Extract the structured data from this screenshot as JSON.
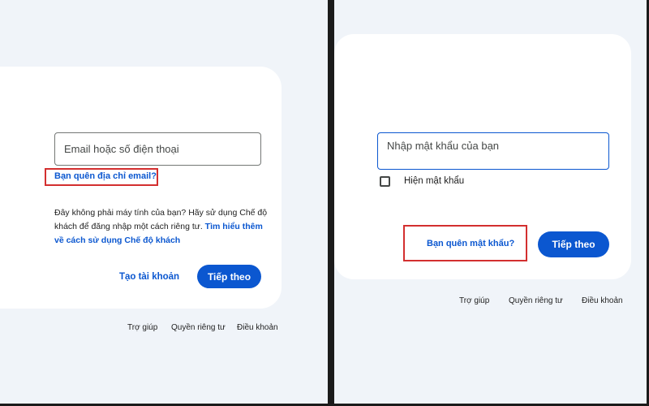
{
  "left_panel": {
    "email_placeholder": "Email hoặc số điện thoại",
    "forgot_email_link": "Bạn quên địa chỉ email?",
    "guest_info_text": "Đây không phải máy tính của bạn? Hãy sử dụng Chế độ khách để đăng nhập một cách riêng tư. ",
    "guest_info_link": "Tìm hiểu thêm về cách sử dụng Chế độ khách",
    "create_account_button": "Tạo tài khoản",
    "next_button": "Tiếp theo",
    "footer": {
      "help": "Trợ giúp",
      "privacy": "Quyền riêng tư",
      "terms": "Điều khoản"
    }
  },
  "right_panel": {
    "password_placeholder": "Nhập mật khẩu của bạn",
    "show_password_label": "Hiện mật khẩu",
    "forgot_password_link": "Bạn quên mật khẩu?",
    "next_button": "Tiếp theo",
    "footer": {
      "help": "Trợ giúp",
      "privacy": "Quyền riêng tư",
      "terms": "Điều khoản"
    }
  },
  "colors": {
    "background": "#f0f4f9",
    "card": "#ffffff",
    "accent": "#0b57d0",
    "highlight_border": "#d32f2f",
    "divider": "#1b1b1b"
  }
}
